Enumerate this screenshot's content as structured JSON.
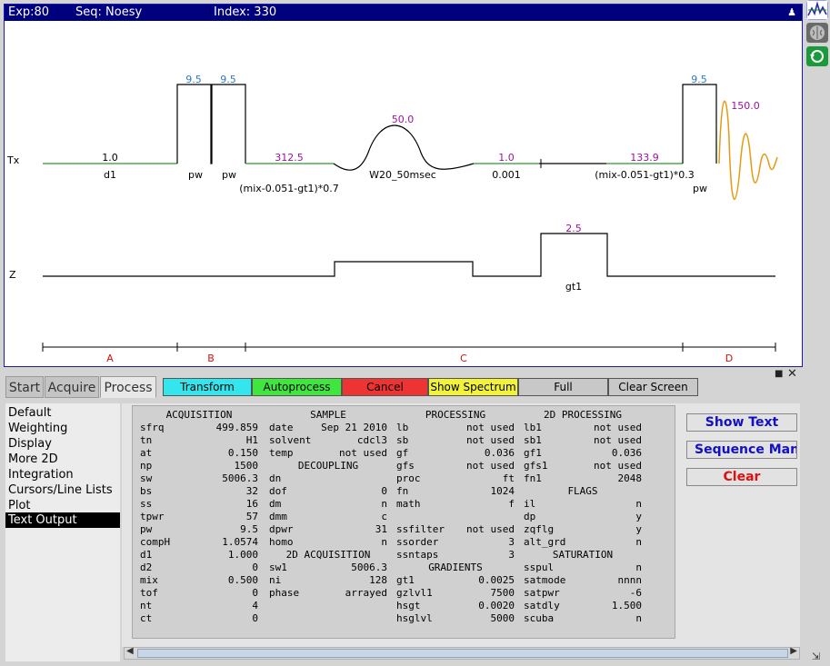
{
  "titlebar": {
    "exp": "Exp:80",
    "seq": "Seq: Noesy",
    "index": "Index: 330"
  },
  "sequence": {
    "channels": [
      "Tx",
      "Z"
    ],
    "tx_top_labels": [
      "9.5",
      "9.5",
      "50.0",
      "9.5",
      "150.0"
    ],
    "tx_power_labels": [
      "1.0",
      "312.5",
      "1.0",
      "133.9"
    ],
    "tx_bottom_labels": [
      "d1",
      "pw",
      "pw",
      "(mix-0.051-gt1)*0.7",
      "W20_50msec",
      "0.001",
      "(mix-0.051-gt1)*0.3",
      "pw"
    ],
    "z_top_label": "2.5",
    "z_bottom_label": "gt1",
    "sections": [
      "A",
      "B",
      "C",
      "D"
    ]
  },
  "tabs": [
    "Start",
    "Acquire",
    "Process"
  ],
  "active_tab": "Process",
  "actions": [
    {
      "label": "Transform",
      "color": "#33e6ee"
    },
    {
      "label": "Autoprocess",
      "color": "#3ee63e"
    },
    {
      "label": "Cancel",
      "color": "#ee3333"
    },
    {
      "label": "Show Spectrum",
      "color": "#f2f23a"
    },
    {
      "label": "Full",
      "color": "#c8c8c8"
    },
    {
      "label": "Clear Screen",
      "color": "#c8c8c8"
    }
  ],
  "menu": [
    "Default",
    "Weighting",
    "Display",
    "More 2D",
    "Integration",
    "Cursors/Line Lists",
    "Plot",
    "Text Output"
  ],
  "menu_selected": "Text Output",
  "text_columns": [
    [
      {
        "h": "ACQUISITION"
      },
      {
        "k": "sfrq",
        "v": "499.859"
      },
      {
        "k": "tn",
        "v": "H1"
      },
      {
        "k": "at",
        "v": "0.150"
      },
      {
        "k": "np",
        "v": "1500"
      },
      {
        "k": "sw",
        "v": "5006.3"
      },
      {
        "k": "bs",
        "v": "32"
      },
      {
        "k": "ss",
        "v": "16"
      },
      {
        "k": "tpwr",
        "v": "57"
      },
      {
        "k": "pw",
        "v": "9.5"
      },
      {
        "k": "compH",
        "v": "1.0574"
      },
      {
        "k": "d1",
        "v": "1.000"
      },
      {
        "k": "d2",
        "v": "0"
      },
      {
        "k": "mix",
        "v": "0.500"
      },
      {
        "k": "tof",
        "v": "0"
      },
      {
        "k": "nt",
        "v": "4"
      },
      {
        "k": "ct",
        "v": "0"
      }
    ],
    [
      {
        "h": "SAMPLE"
      },
      {
        "k": "date",
        "v": "Sep 21 2010"
      },
      {
        "k": "solvent",
        "v": "cdcl3"
      },
      {
        "k": "temp",
        "v": "not used"
      },
      {
        "h": "DECOUPLING"
      },
      {
        "k": "dn",
        "v": ""
      },
      {
        "k": "dof",
        "v": "0"
      },
      {
        "k": "dm",
        "v": "n"
      },
      {
        "k": "dmm",
        "v": "c"
      },
      {
        "k": "dpwr",
        "v": "31"
      },
      {
        "k": "homo",
        "v": "n"
      },
      {
        "h": "2D ACQUISITION"
      },
      {
        "k": "sw1",
        "v": "5006.3"
      },
      {
        "k": "ni",
        "v": "128"
      },
      {
        "k": "phase",
        "v": "arrayed"
      }
    ],
    [
      {
        "h": "PROCESSING"
      },
      {
        "k": "lb",
        "v": "not used"
      },
      {
        "k": "sb",
        "v": "not used"
      },
      {
        "k": "gf",
        "v": "0.036"
      },
      {
        "k": "gfs",
        "v": "not used"
      },
      {
        "k": "proc",
        "v": "ft"
      },
      {
        "k": "fn",
        "v": "1024"
      },
      {
        "k": "math",
        "v": "f"
      },
      {
        "k": "",
        "v": ""
      },
      {
        "k": "ssfilter",
        "v": "not used"
      },
      {
        "k": "ssorder",
        "v": "3"
      },
      {
        "k": "ssntaps",
        "v": "3"
      },
      {
        "h": "GRADIENTS"
      },
      {
        "k": "gt1",
        "v": "0.0025"
      },
      {
        "k": "gzlvl1",
        "v": "7500"
      },
      {
        "k": "hsgt",
        "v": "0.0020"
      },
      {
        "k": "hsglvl",
        "v": "5000"
      }
    ],
    [
      {
        "h": "2D PROCESSING"
      },
      {
        "k": "lb1",
        "v": "not used"
      },
      {
        "k": "sb1",
        "v": "not used"
      },
      {
        "k": "gf1",
        "v": "0.036"
      },
      {
        "k": "gfs1",
        "v": "not used"
      },
      {
        "k": "fn1",
        "v": "2048"
      },
      {
        "h": "FLAGS"
      },
      {
        "k": "il",
        "v": "n"
      },
      {
        "k": "dp",
        "v": "y"
      },
      {
        "k": "zqflg",
        "v": "y"
      },
      {
        "k": "alt_grd",
        "v": "n"
      },
      {
        "h": "SATURATION"
      },
      {
        "k": "sspul",
        "v": "n"
      },
      {
        "k": "satmode",
        "v": "nnnn"
      },
      {
        "k": "satpwr",
        "v": "-6"
      },
      {
        "k": "satdly",
        "v": "1.500"
      },
      {
        "k": "scuba",
        "v": "n"
      }
    ]
  ],
  "side_buttons": [
    {
      "label": "Show Text",
      "color": "#1010c8"
    },
    {
      "label": "Sequence Manual",
      "color": "#1010c8"
    },
    {
      "label": "Clear",
      "color": "#e01010"
    }
  ],
  "icons": [
    "spectrum-icon",
    "brain-icon",
    "refresh-icon",
    "user-icon",
    "pin-icon",
    "close-icon"
  ]
}
